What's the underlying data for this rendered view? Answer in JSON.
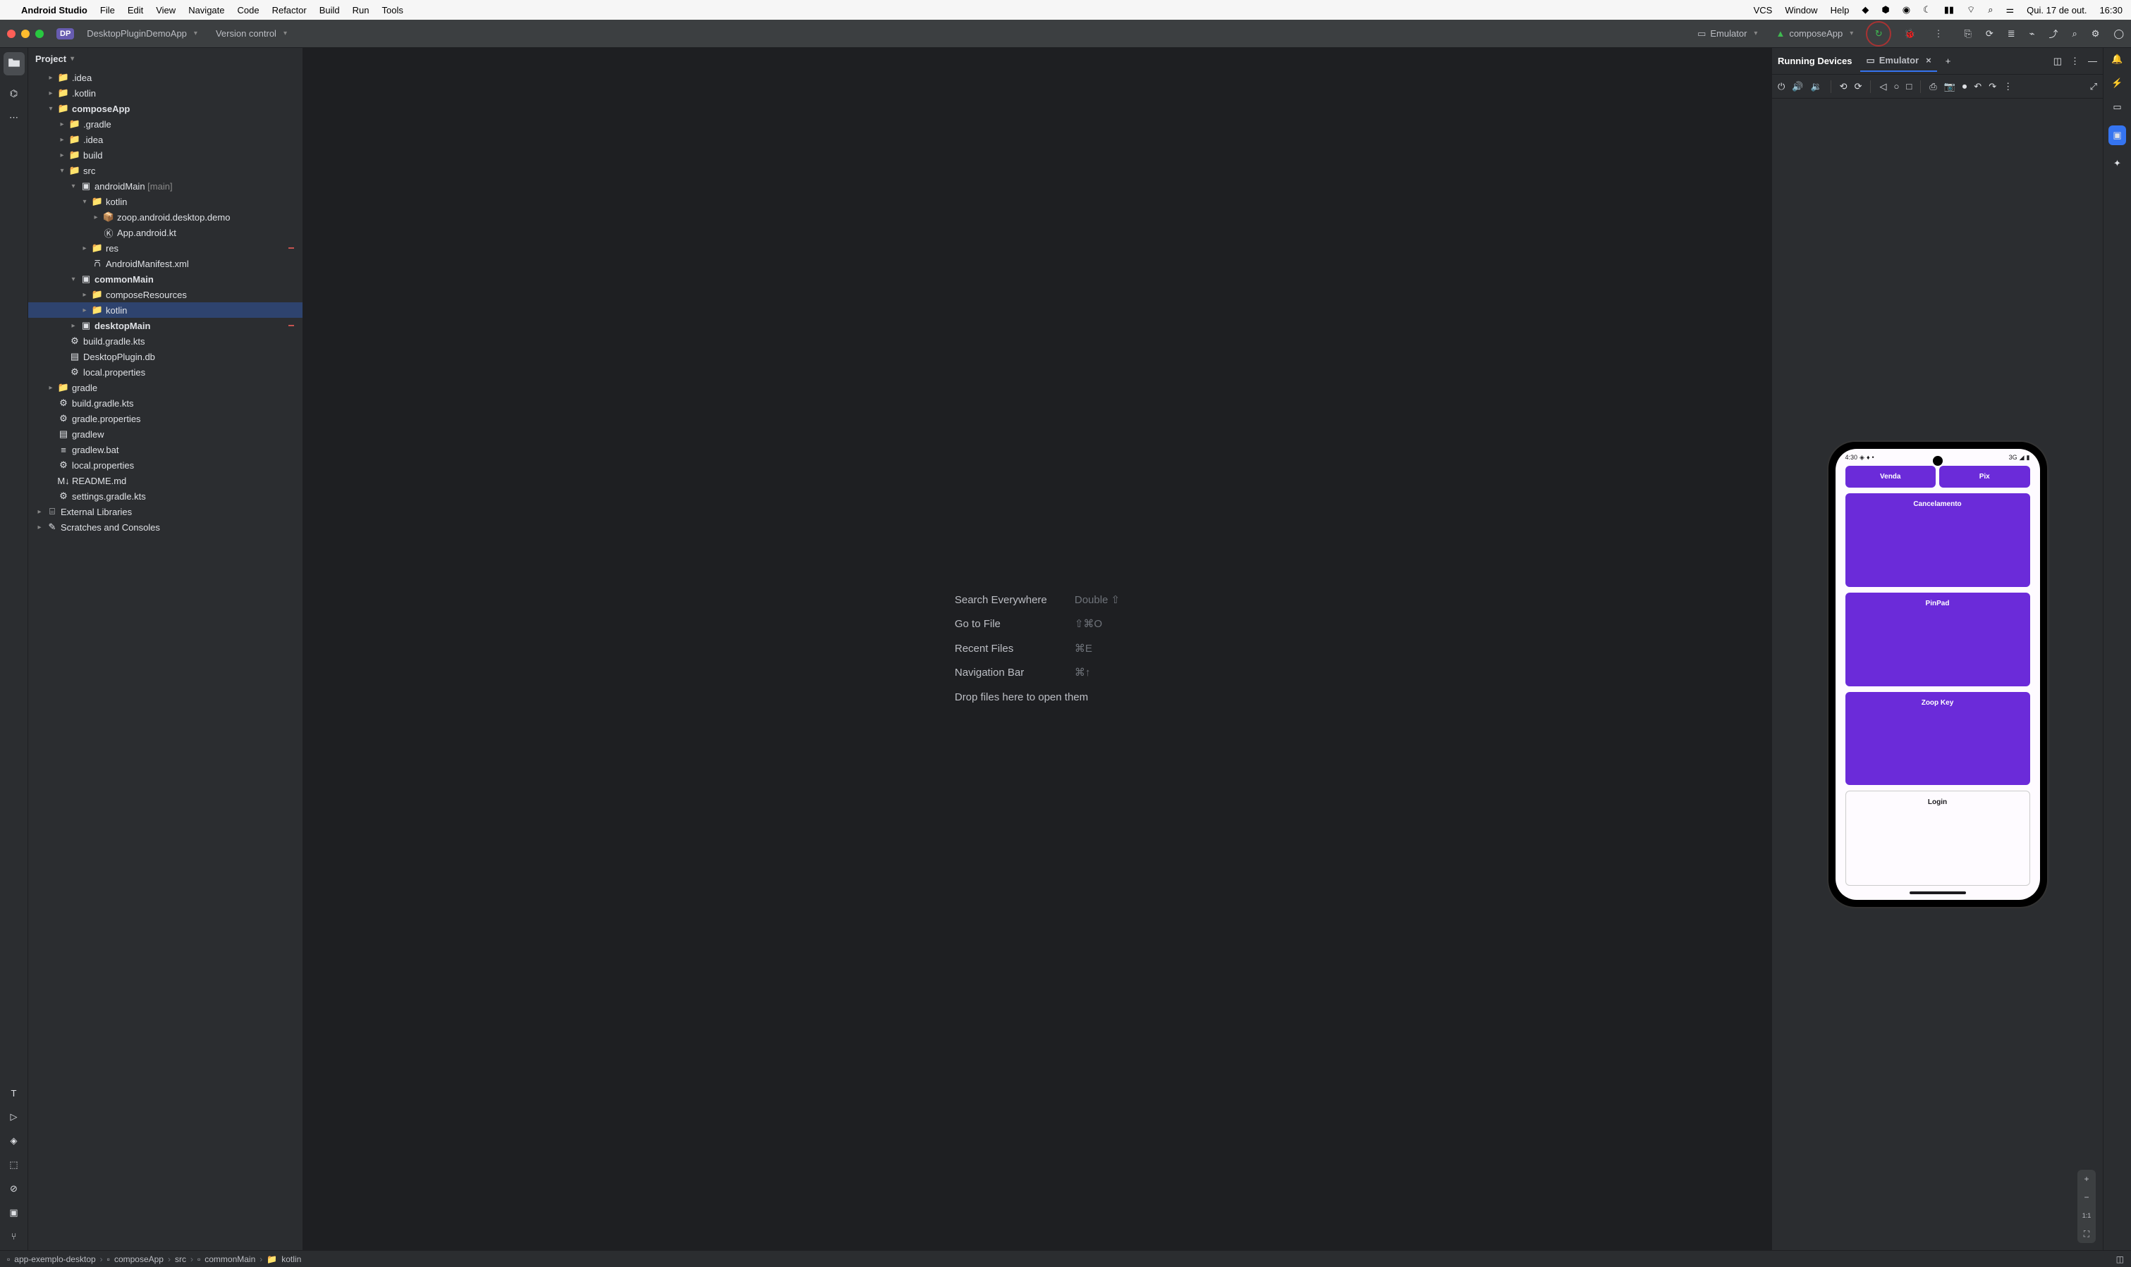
{
  "macos": {
    "app": "Android Studio",
    "menus": [
      "File",
      "Edit",
      "View",
      "Navigate",
      "Code",
      "Refactor",
      "Build",
      "Run",
      "Tools",
      "VCS",
      "Window",
      "Help"
    ],
    "date": "Qui. 17 de out.",
    "time": "16:30"
  },
  "titlebar": {
    "project_badge": "DP",
    "project_name": "DesktopPluginDemoApp",
    "vcs_label": "Version control",
    "target_label": "Emulator",
    "config_label": "composeApp"
  },
  "project": {
    "header": "Project",
    "tree": [
      {
        "d": 1,
        "chev": "▸",
        "icon": "folder",
        "label": ".idea"
      },
      {
        "d": 1,
        "chev": "▸",
        "icon": "folder",
        "label": ".kotlin"
      },
      {
        "d": 1,
        "chev": "▾",
        "icon": "folder",
        "label": "composeApp",
        "bold": true
      },
      {
        "d": 2,
        "chev": "▸",
        "icon": "folder",
        "label": ".gradle"
      },
      {
        "d": 2,
        "chev": "▸",
        "icon": "folder",
        "label": ".idea"
      },
      {
        "d": 2,
        "chev": "▸",
        "icon": "folder",
        "label": "build"
      },
      {
        "d": 2,
        "chev": "▾",
        "icon": "folder",
        "label": "src"
      },
      {
        "d": 3,
        "chev": "▾",
        "icon": "module",
        "label": "androidMain",
        "suffix": " [main]"
      },
      {
        "d": 4,
        "chev": "▾",
        "icon": "folder-src",
        "label": "kotlin"
      },
      {
        "d": 5,
        "chev": "▸",
        "icon": "package",
        "label": "zoop.android.desktop.demo"
      },
      {
        "d": 5,
        "chev": "",
        "icon": "kt",
        "label": "App.android.kt"
      },
      {
        "d": 4,
        "chev": "▸",
        "icon": "folder-res",
        "label": "res",
        "mark": true
      },
      {
        "d": 4,
        "chev": "",
        "icon": "xml",
        "label": "AndroidManifest.xml"
      },
      {
        "d": 3,
        "chev": "▾",
        "icon": "module",
        "label": "commonMain",
        "bold": true
      },
      {
        "d": 4,
        "chev": "▸",
        "icon": "folder-res",
        "label": "composeResources"
      },
      {
        "d": 4,
        "chev": "▸",
        "icon": "folder-src",
        "label": "kotlin",
        "selected": true
      },
      {
        "d": 3,
        "chev": "▸",
        "icon": "module",
        "label": "desktopMain",
        "bold": true,
        "mark": true
      },
      {
        "d": 2,
        "chev": "",
        "icon": "gradle",
        "label": "build.gradle.kts"
      },
      {
        "d": 2,
        "chev": "",
        "icon": "file",
        "label": "DesktopPlugin.db"
      },
      {
        "d": 2,
        "chev": "",
        "icon": "gear",
        "label": "local.properties"
      },
      {
        "d": 1,
        "chev": "▸",
        "icon": "folder",
        "label": "gradle"
      },
      {
        "d": 1,
        "chev": "",
        "icon": "gradle",
        "label": "build.gradle.kts"
      },
      {
        "d": 1,
        "chev": "",
        "icon": "gear",
        "label": "gradle.properties"
      },
      {
        "d": 1,
        "chev": "",
        "icon": "sh",
        "label": "gradlew"
      },
      {
        "d": 1,
        "chev": "",
        "icon": "txt",
        "label": "gradlew.bat"
      },
      {
        "d": 1,
        "chev": "",
        "icon": "gear",
        "label": "local.properties"
      },
      {
        "d": 1,
        "chev": "",
        "icon": "md",
        "label": "README.md"
      },
      {
        "d": 1,
        "chev": "",
        "icon": "gradle",
        "label": "settings.gradle.kts"
      },
      {
        "d": 0,
        "chev": "▸",
        "icon": "lib",
        "label": "External Libraries"
      },
      {
        "d": 0,
        "chev": "▸",
        "icon": "scratch",
        "label": "Scratches and Consoles"
      }
    ]
  },
  "hints": [
    {
      "title": "Search Everywhere",
      "key": "Double ⇧"
    },
    {
      "title": "Go to File",
      "key": "⇧⌘O"
    },
    {
      "title": "Recent Files",
      "key": "⌘E"
    },
    {
      "title": "Navigation Bar",
      "key": "⌘↑"
    },
    {
      "title": "Drop files here to open them",
      "key": ""
    }
  ],
  "emulator": {
    "running_label": "Running Devices",
    "tab_label": "Emulator",
    "statusbar": {
      "time": "4:30",
      "signal": "3G"
    },
    "buttons": {
      "venda": "Venda",
      "pix": "Pix",
      "cancel": "Cancelamento",
      "pinpad": "PinPad",
      "zoop": "Zoop Key",
      "login": "Login"
    },
    "zoom_11": "1:1"
  },
  "breadcrumbs": [
    "app-exemplo-desktop",
    "composeApp",
    "src",
    "commonMain",
    "kotlin"
  ]
}
